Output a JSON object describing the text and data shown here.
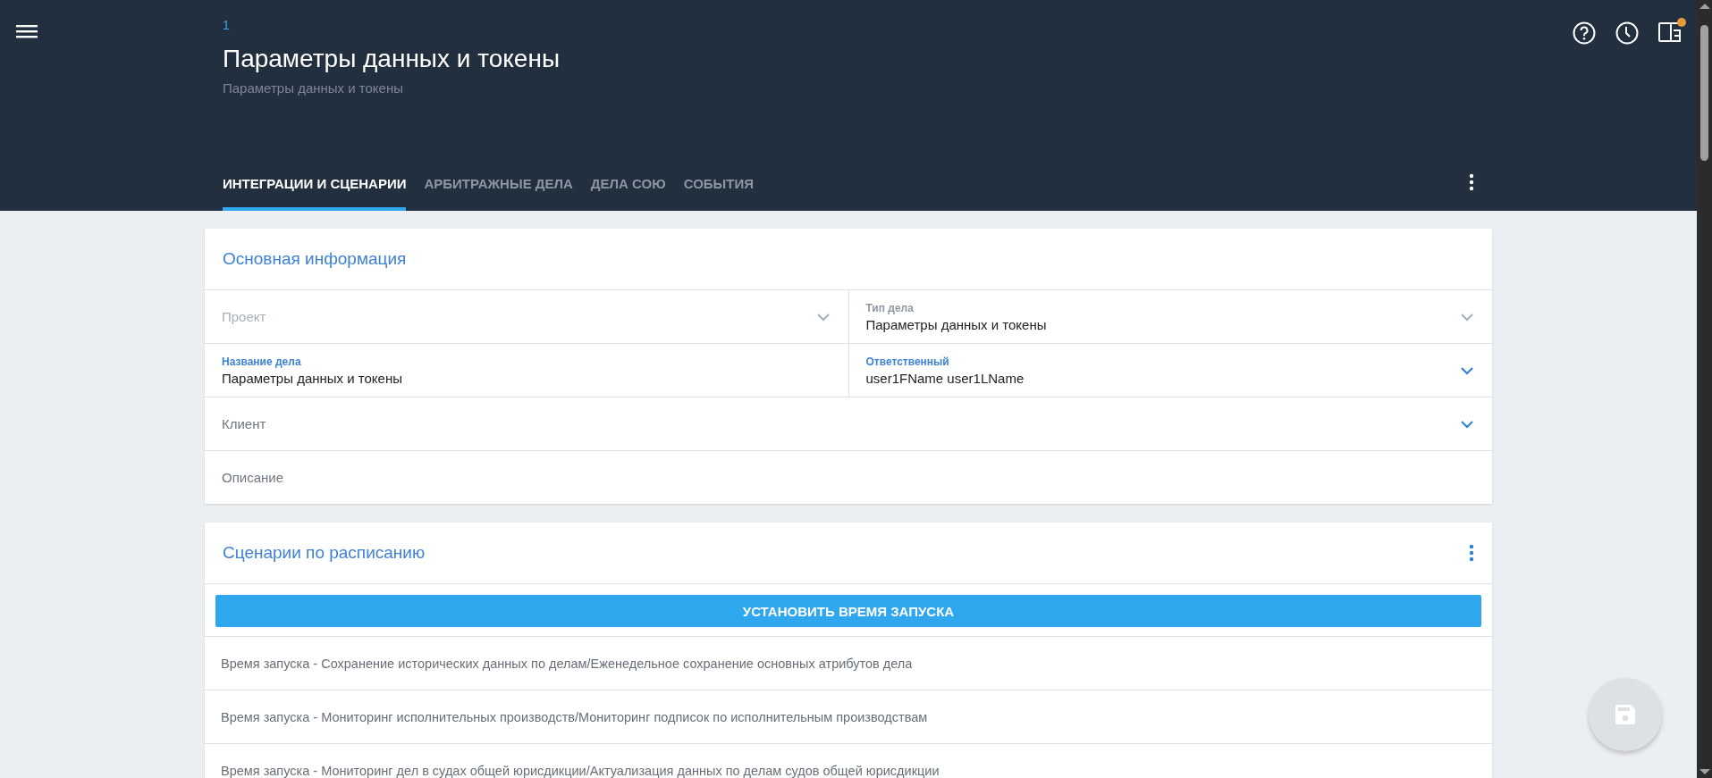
{
  "header": {
    "record_number": "1",
    "title": "Параметры данных и токены",
    "subtitle": "Параметры данных и токены",
    "notification_dot": true
  },
  "tabs": [
    {
      "label": "ИНТЕГРАЦИИ И СЦЕНАРИИ",
      "selected": true
    },
    {
      "label": "АРБИТРАЖНЫЕ ДЕЛА",
      "selected": false
    },
    {
      "label": "ДЕЛА СОЮ",
      "selected": false
    },
    {
      "label": "СОБЫТИЯ",
      "selected": false
    }
  ],
  "main_info": {
    "title": "Основная информация",
    "rows": [
      {
        "fields": [
          {
            "kind": "select",
            "label": "Проект",
            "disabled": true
          },
          {
            "kind": "select",
            "label": "Тип дела",
            "value": "Параметры данных и токены",
            "disabled": true
          }
        ]
      },
      {
        "fields": [
          {
            "kind": "text",
            "label": "Название дела",
            "value": "Параметры данных и токены",
            "disabled": false
          },
          {
            "kind": "select",
            "label": "Ответственный",
            "value": "user1FName user1LName",
            "disabled": false
          }
        ]
      },
      {
        "fields": [
          {
            "kind": "select",
            "label": "Клиент",
            "disabled": false
          }
        ]
      },
      {
        "fields": [
          {
            "kind": "text",
            "label": "Описание",
            "disabled": false
          }
        ]
      }
    ]
  },
  "scenarios": {
    "title": "Сценарии по расписанию",
    "button": "УСТАНОВИТЬ ВРЕМЯ ЗАПУСКА",
    "items": [
      "Время запуска - Сохранение исторических данных по делам/Еженедельное сохранение основных атрибутов дела",
      "Время запуска - Мониторинг исполнительных производств/Мониторинг подписок по исполнительным производствам",
      "Время запуска - Мониторинг дел в судах общей юрисдикции/Актуализация данных по делам судов общей юрисдикции"
    ]
  }
}
